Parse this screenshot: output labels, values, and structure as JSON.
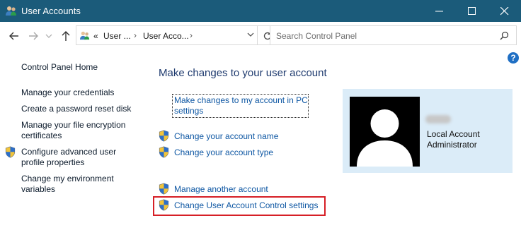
{
  "window": {
    "title": "User Accounts"
  },
  "address": {
    "overflow": "«",
    "crumbs": [
      "User ...",
      "User Acco..."
    ],
    "separator": "›"
  },
  "search": {
    "placeholder": "Search Control Panel"
  },
  "help": {
    "label": "?"
  },
  "sidebar": {
    "home": "Control Panel Home",
    "items": [
      {
        "lines": [
          "Manage your credentials"
        ],
        "shield": false
      },
      {
        "lines": [
          "Create a password reset disk"
        ],
        "shield": false
      },
      {
        "lines": [
          "Manage your file encryption",
          "certificates"
        ],
        "shield": false
      },
      {
        "lines": [
          "Configure advanced user",
          "profile properties"
        ],
        "shield": true
      },
      {
        "lines": [
          "Change my environment",
          "variables"
        ],
        "shield": false
      }
    ]
  },
  "main": {
    "heading": "Make changes to your user account",
    "pc_settings_link": [
      "Make changes to my account in PC",
      "settings"
    ],
    "links": [
      {
        "label": "Change your account name",
        "shield": true
      },
      {
        "label": "Change your account type",
        "shield": true
      },
      {
        "label": "Manage another account",
        "shield": true
      },
      {
        "label": "Change User Account Control settings",
        "shield": true,
        "highlighted": true
      }
    ]
  },
  "account": {
    "type": "Local Account",
    "role": "Administrator"
  },
  "colors": {
    "titlebar": "#1b5b7a",
    "link": "#0e57a3",
    "heading": "#1e3a6e",
    "card": "#dbecf8",
    "highlight": "#d61f26"
  },
  "icons": {
    "app": "user-accounts-icon",
    "shield": "uac-shield-icon",
    "avatar": "default-user-avatar"
  }
}
